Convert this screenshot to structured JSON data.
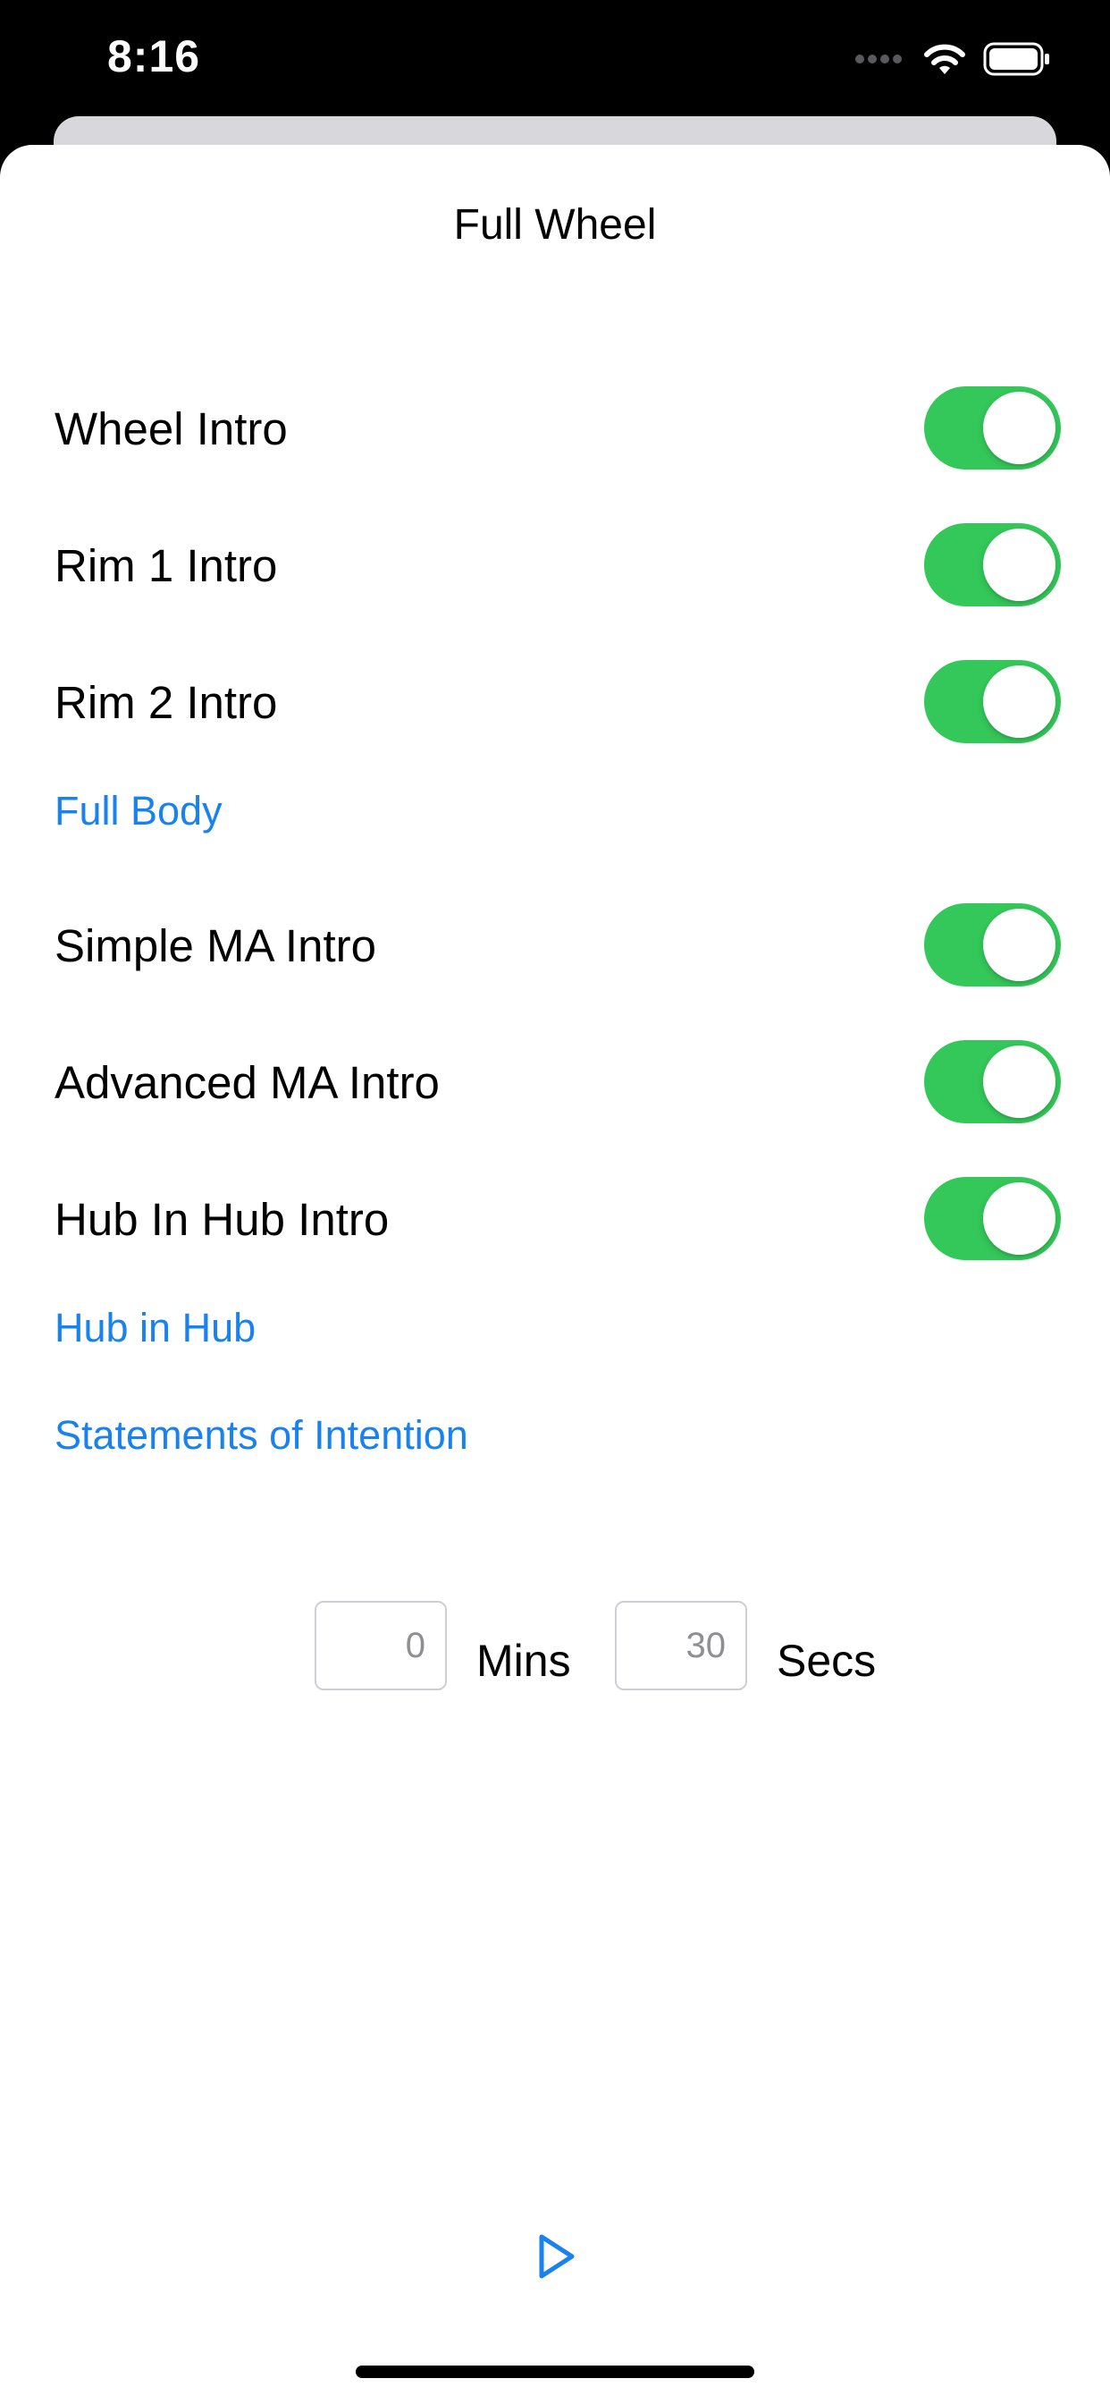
{
  "status_bar": {
    "time": "8:16"
  },
  "sheet": {
    "title": "Full Wheel"
  },
  "toggles": [
    {
      "label": "Wheel Intro",
      "on": true
    },
    {
      "label": "Rim 1 Intro",
      "on": true
    },
    {
      "label": "Rim 2 Intro",
      "on": true
    },
    {
      "label": "Simple MA Intro",
      "on": true
    },
    {
      "label": "Advanced MA Intro",
      "on": true
    },
    {
      "label": "Hub In Hub Intro",
      "on": true
    }
  ],
  "links": {
    "full_body": "Full Body",
    "hub_in_hub": "Hub in Hub",
    "statements": "Statements of Intention"
  },
  "timer": {
    "mins_placeholder": "0",
    "mins_label": "Mins",
    "secs_placeholder": "30",
    "secs_label": "Secs"
  },
  "colors": {
    "accent": "#1a82ee",
    "toggle_on": "#34c759"
  },
  "icons": {
    "play": "play-icon"
  }
}
